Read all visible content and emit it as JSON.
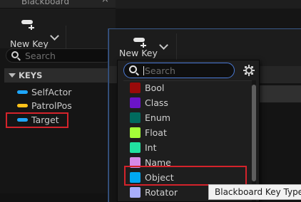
{
  "blackboard": {
    "tab_title": "Blackboard",
    "close_glyph": "×",
    "new_key_label": "New Key",
    "search_placeholder": "Search",
    "keys_header": "KEYS",
    "keys": [
      {
        "label": "SelfActor",
        "color": "#1ea7ff"
      },
      {
        "label": "PatrolPos",
        "color": "#ffc21a"
      },
      {
        "label": "Target",
        "color": "#1ea7ff"
      }
    ]
  },
  "new_key_panel": {
    "new_key_label": "New Key"
  },
  "key_type_menu": {
    "search_placeholder": "Search",
    "settings_icon": "gear-icon",
    "types": [
      {
        "label": "Bool",
        "color": "#9a0a0a"
      },
      {
        "label": "Class",
        "color": "#6a14c8"
      },
      {
        "label": "Enum",
        "color": "#006b5e"
      },
      {
        "label": "Float",
        "color": "#a4ff38"
      },
      {
        "label": "Int",
        "color": "#21e2a0"
      },
      {
        "label": "Name",
        "color": "#d68ae8"
      },
      {
        "label": "Object",
        "color": "#00a8f2"
      },
      {
        "label": "Rotator",
        "color": "#a8aefc"
      }
    ]
  },
  "tooltip": {
    "text": "Blackboard Key Type C"
  },
  "colors": {
    "highlight": "#d4232b",
    "focus_border": "#4b7ad6"
  }
}
